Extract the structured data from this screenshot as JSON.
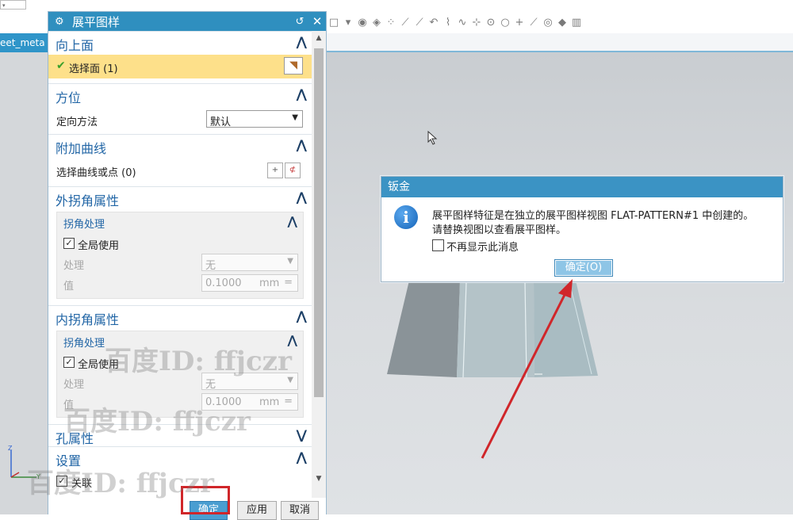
{
  "topbar": {
    "mini_dropdown": "▾"
  },
  "toolbar_icons": [
    "□",
    "▾",
    "◉",
    "◈",
    "⁘",
    "⟋",
    "⟋",
    "↶",
    "⌇",
    "∿",
    "⊹",
    "⊙",
    "○",
    "+",
    "⟋",
    "◎",
    "◆",
    "▥"
  ],
  "tab": {
    "label": "eet_meta"
  },
  "dialog": {
    "title": "展平图样",
    "groups": {
      "upward_face": {
        "label": "向上面",
        "select_label": "选择面 (1)"
      },
      "orientation": {
        "label": "方位",
        "method_label": "定向方法",
        "method_value": "默认"
      },
      "extra_curves": {
        "label": "附加曲线",
        "select_label": "选择曲线或点 (0)"
      },
      "outer_corner": {
        "label": "外拐角属性",
        "sub_title": "拐角处理",
        "global_label": "全局使用",
        "treatment_label": "处理",
        "treatment_value": "无",
        "value_label": "值",
        "value": "0.1000",
        "unit": "mm",
        "eq": "="
      },
      "inner_corner": {
        "label": "内拐角属性",
        "sub_title": "拐角处理",
        "global_label": "全局使用",
        "treatment_label": "处理",
        "treatment_value": "无",
        "value_label": "值",
        "value": "0.1000",
        "unit": "mm",
        "eq": "="
      },
      "hole_props": {
        "label": "孔属性"
      },
      "settings": {
        "label": "设置",
        "associative_label": "关联"
      }
    },
    "buttons": {
      "ok": "确定",
      "apply": "应用",
      "cancel": "取消"
    }
  },
  "message": {
    "title": "钣金",
    "line1": "展平图样特征是在独立的展平图样视图 FLAT-PATTERN#1 中创建的。",
    "line2": "请替换视图以查看展平图样。",
    "checkbox_label": "不再显示此消息",
    "ok": "确定(O)"
  },
  "watermark": "百度ID: ffjczr",
  "colors": {
    "title_bar": "#2f8fbf",
    "highlight": "#fde08a",
    "annotation": "#d0262a"
  }
}
